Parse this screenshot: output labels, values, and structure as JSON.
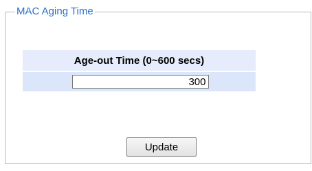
{
  "section": {
    "title": "MAC Aging Time"
  },
  "table": {
    "header": "Age-out Time (0~600 secs)",
    "value": "300"
  },
  "actions": {
    "update_label": "Update"
  },
  "colors": {
    "legend_text": "#2b6fc9",
    "header_bg": "#e6ecfb",
    "value_row_bg": "#dce6fb",
    "border": "#b7b7b7"
  }
}
